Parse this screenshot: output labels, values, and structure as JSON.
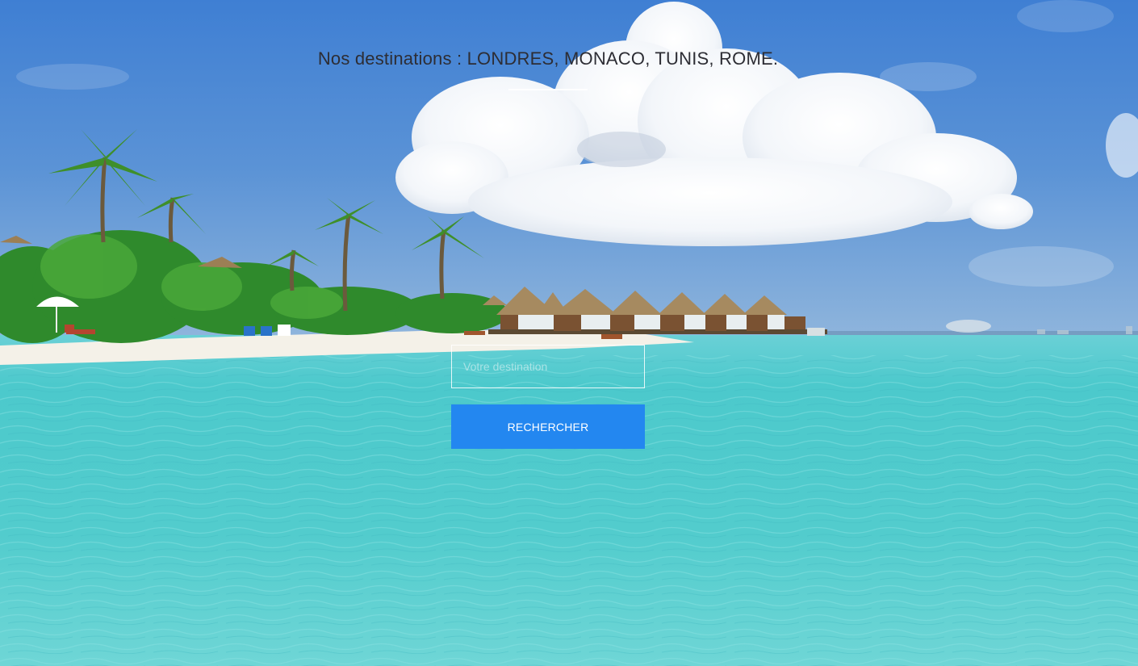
{
  "hero": {
    "heading": "Nos destinations : LONDRES, MONACO, TUNIS, ROME.",
    "background": "tropical-beach-photo"
  },
  "search": {
    "placeholder": "Votre destination",
    "value": "",
    "button_label": "RECHERCHER"
  },
  "colors": {
    "accent": "#2387f0",
    "heading_text": "#2d2d34",
    "sky": "#4f8ad2",
    "water": "#5fd3d3"
  }
}
